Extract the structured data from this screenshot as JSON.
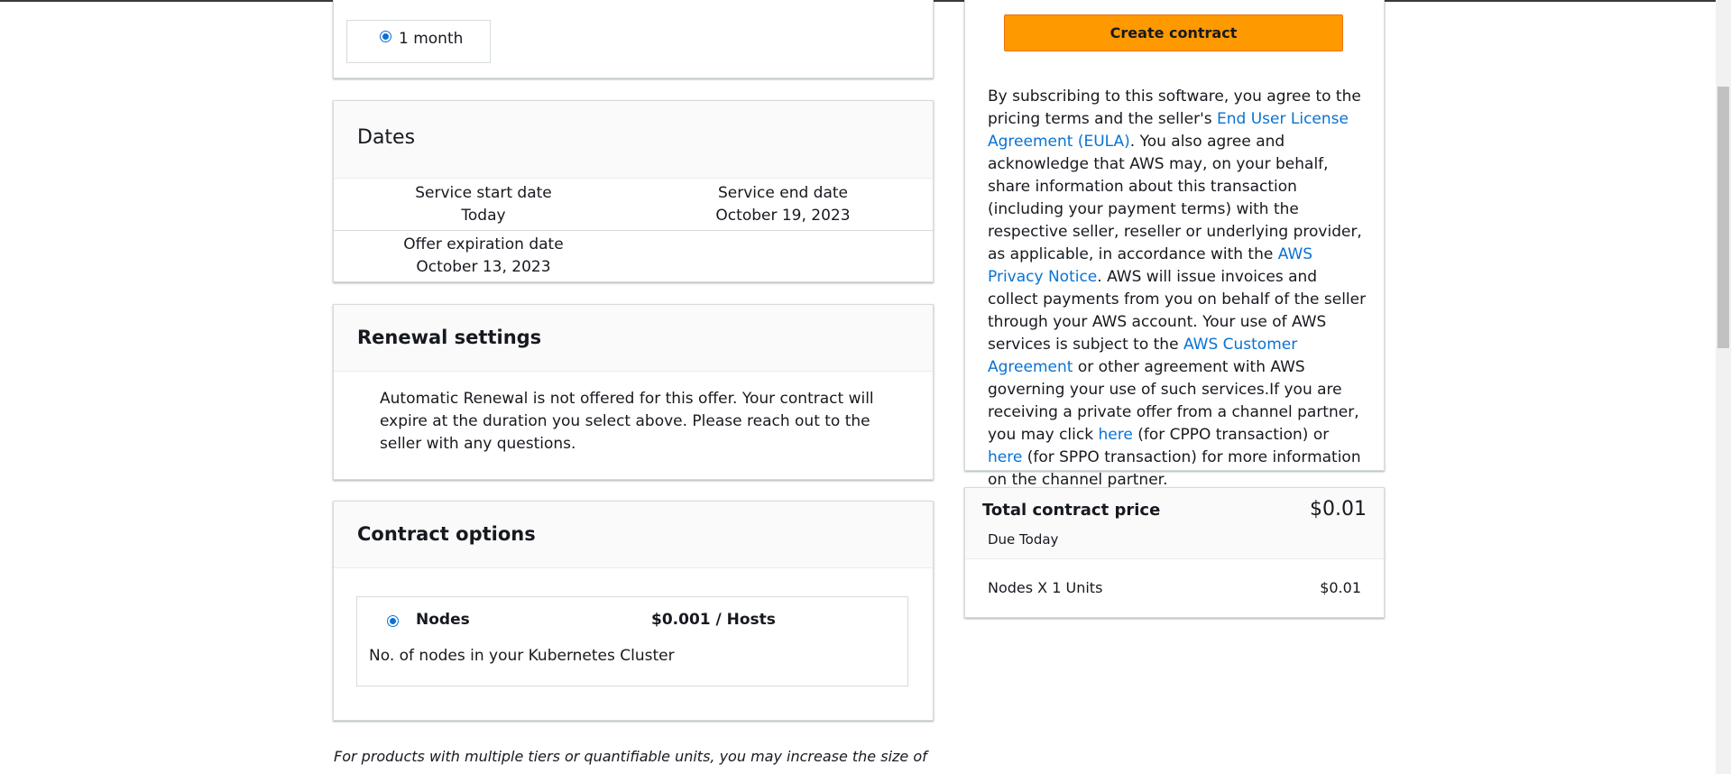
{
  "duration": {
    "option_label": "1 month"
  },
  "dates": {
    "title": "Dates",
    "service_start_label": "Service start date",
    "service_start_value": "Today",
    "service_end_label": "Service end date",
    "service_end_value": "October 19, 2023",
    "offer_expiration_label": "Offer expiration date",
    "offer_expiration_value": "October 13, 2023"
  },
  "renewal": {
    "title": "Renewal settings",
    "text": "Automatic Renewal is not offered for this offer. Your contract will expire at the duration you select above. Please reach out to the seller with any questions."
  },
  "contract_options": {
    "title": "Contract options",
    "option_name": "Nodes",
    "option_price": "$0.001 / Hosts",
    "option_description": "No. of nodes in your Kubernetes Cluster"
  },
  "footnote": "For products with multiple tiers or quantifiable units, you may increase the size of",
  "sidebar": {
    "create_button": "Create contract",
    "terms": {
      "t1": "By subscribing to this software, you agree to the pricing terms and the seller's ",
      "link_eula": "End User License Agreement (EULA)",
      "t2": ". You also agree and acknowledge that AWS may, on your behalf, share information about this transaction (including your payment terms) with the respective seller, reseller or underlying provider, as applicable, in accordance with the ",
      "link_privacy": "AWS Privacy Notice",
      "t3": ". AWS will issue invoices and collect payments from you on behalf of the seller through your AWS account. Your use of AWS services is subject to the ",
      "link_customer": "AWS Customer Agreement",
      "t4": " or other agreement with AWS governing your use of such services.If you are receiving a private offer from a channel partner, you may click ",
      "link_here1": "here",
      "t5": " (for CPPO transaction) or ",
      "link_here2": "here",
      "t6": " (for SPPO transaction) for more information on the channel partner."
    },
    "total": {
      "label": "Total contract price",
      "amount": "$0.01",
      "due": "Due Today",
      "line_label": "Nodes X 1 Units",
      "line_amount": "$0.01"
    }
  },
  "colors": {
    "accent_link": "#0972d3",
    "primary_button": "#ff9900",
    "panel_header_bg": "#fafafa"
  }
}
